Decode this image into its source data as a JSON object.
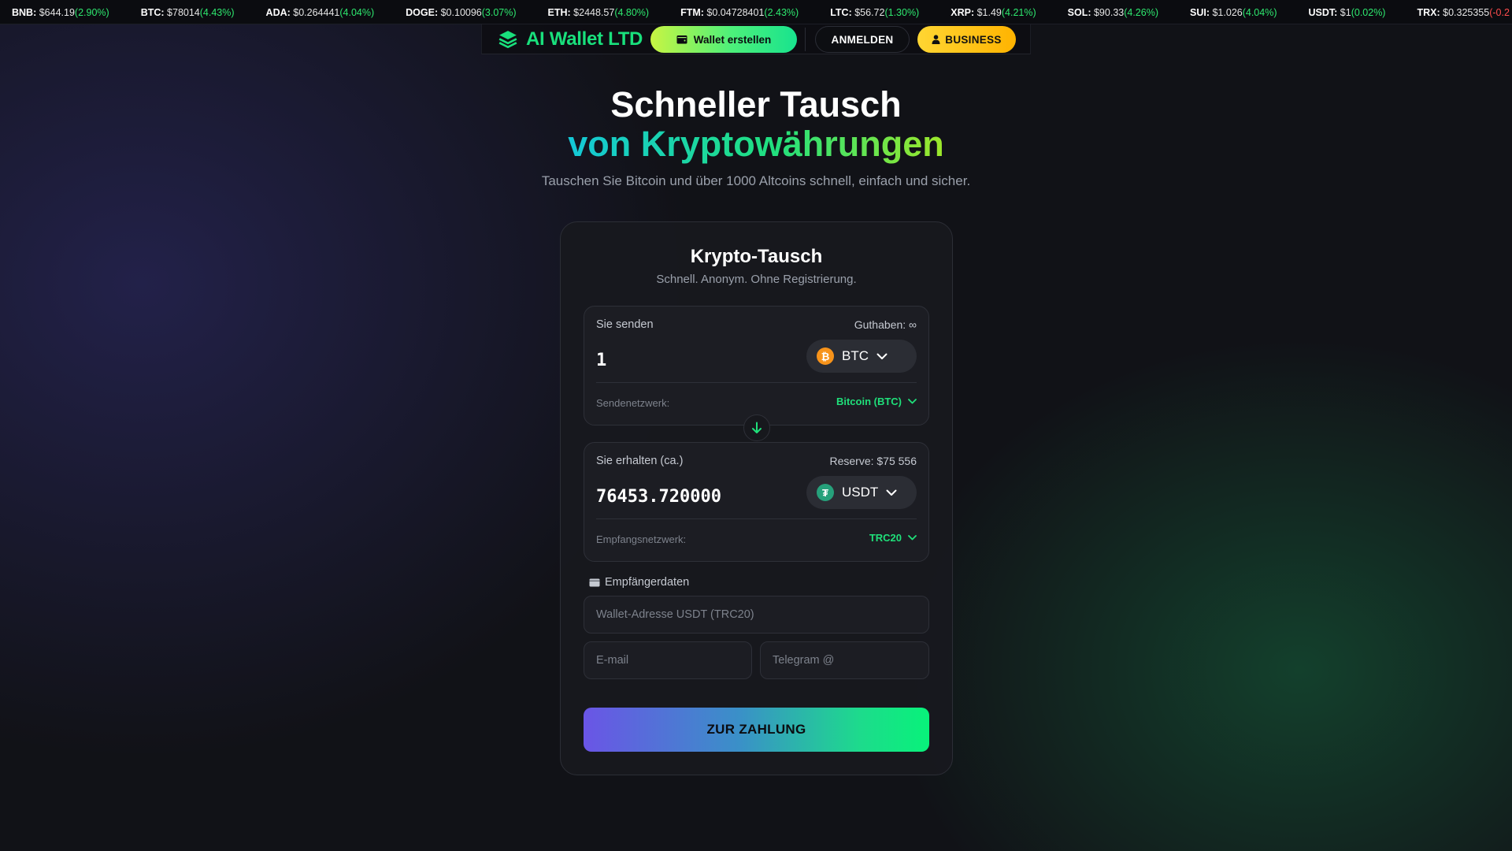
{
  "ticker": [
    {
      "symbol": "BNB",
      "price": "$644.19",
      "change": "(2.90%)",
      "negative": false
    },
    {
      "symbol": "BTC",
      "price": "$78014",
      "change": "(4.43%)",
      "negative": false
    },
    {
      "symbol": "ADA",
      "price": "$0.264441",
      "change": "(4.04%)",
      "negative": false
    },
    {
      "symbol": "DOGE",
      "price": "$0.10096",
      "change": "(3.07%)",
      "negative": false
    },
    {
      "symbol": "ETH",
      "price": "$2448.57",
      "change": "(4.80%)",
      "negative": false
    },
    {
      "symbol": "FTM",
      "price": "$0.04728401",
      "change": "(2.43%)",
      "negative": false
    },
    {
      "symbol": "LTC",
      "price": "$56.72",
      "change": "(1.30%)",
      "negative": false
    },
    {
      "symbol": "XRP",
      "price": "$1.49",
      "change": "(4.21%)",
      "negative": false
    },
    {
      "symbol": "SOL",
      "price": "$90.33",
      "change": "(4.26%)",
      "negative": false
    },
    {
      "symbol": "SUI",
      "price": "$1.026",
      "change": "(4.04%)",
      "negative": false
    },
    {
      "symbol": "USDT",
      "price": "$1",
      "change": "(0.02%)",
      "negative": false
    },
    {
      "symbol": "TRX",
      "price": "$0.325355",
      "change": "(-0.2",
      "negative": true
    }
  ],
  "nav": {
    "logo_text": "AI Wallet LTD",
    "logo_icon": "layers-icon",
    "wallet_button": "Wallet erstellen",
    "wallet_icon": "wallet-icon",
    "login_button": "ANMELDEN",
    "business_button": "BUSINESS",
    "business_icon": "user-icon"
  },
  "hero": {
    "title_line1": "Schneller Tausch",
    "title_line2": "von Kryptowährungen",
    "subtitle": "Tauschen Sie Bitcoin und über 1000 Altcoins schnell, einfach und sicher."
  },
  "exchange": {
    "title": "Krypto-Tausch",
    "subtitle": "Schnell. Anonym. Ohne Registrierung.",
    "send": {
      "label": "Sie senden",
      "balance": "Guthaben: ∞",
      "amount": "1",
      "coin": "BTC",
      "coin_icon": "bitcoin-icon",
      "network_label": "Sendenetzwerk:",
      "network_value": "Bitcoin (BTC)"
    },
    "receive": {
      "label": "Sie erhalten (ca.)",
      "reserve": "Reserve: $75 556",
      "amount": "76453.720000",
      "coin": "USDT",
      "coin_icon": "tether-icon",
      "network_label": "Empfangsnetzwerk:",
      "network_value": "TRC20"
    },
    "recipient": {
      "label": "Empfängerdaten",
      "wallet_placeholder": "Wallet-Adresse USDT (TRC20)",
      "email_placeholder": "E-mail",
      "telegram_placeholder": "Telegram @"
    },
    "submit_button": "ZUR ZAHLUNG"
  },
  "colors": {
    "accent_green": "#1fe07a",
    "business_yellow": "#ffc107",
    "background": "#111217",
    "ticker_positive": "#2ee86f",
    "ticker_negative": "#ff4d4d"
  }
}
